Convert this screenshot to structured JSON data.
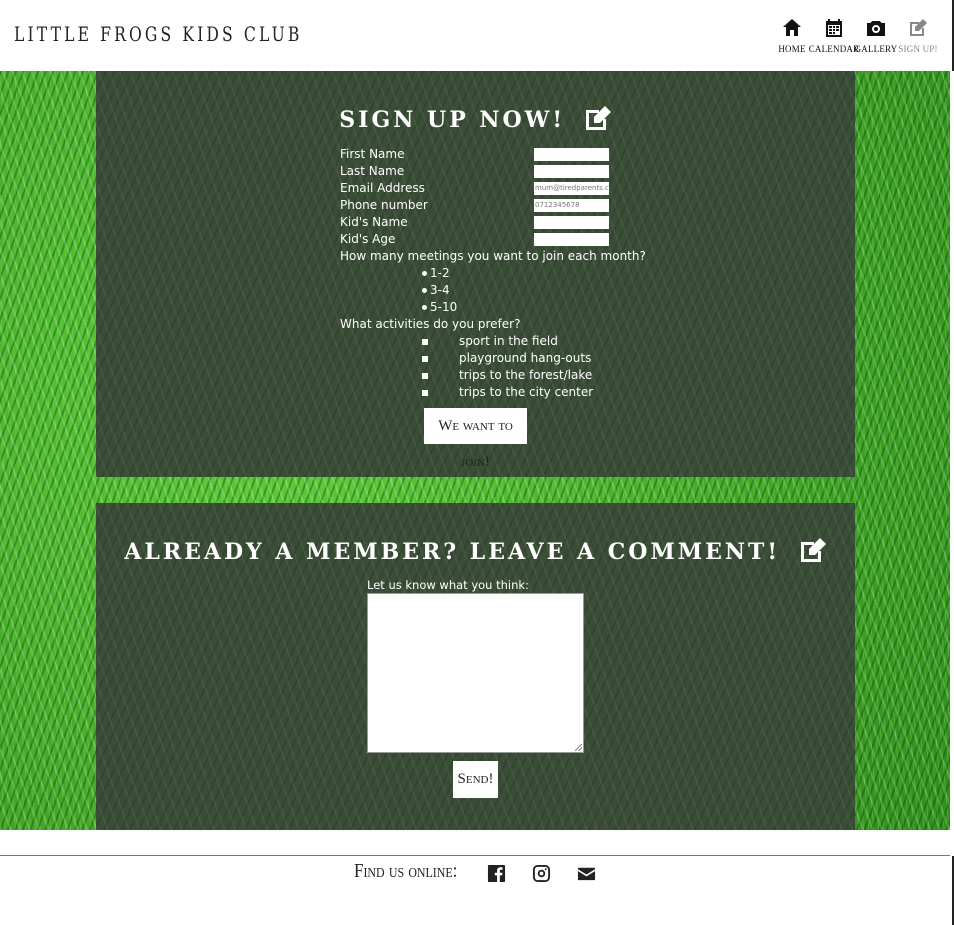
{
  "header": {
    "brand": "LITTLE FROGS KIDS CLUB",
    "nav": [
      {
        "label": "HOME",
        "icon": "home-icon"
      },
      {
        "label": "CALENDAR",
        "icon": "calendar-icon"
      },
      {
        "label": "GALLERY",
        "icon": "camera-icon"
      },
      {
        "label": "SIGN UP!",
        "icon": "edit-icon"
      }
    ]
  },
  "signup": {
    "title": "SIGN UP NOW!",
    "fields": [
      {
        "label": "First Name",
        "value": ""
      },
      {
        "label": "Last Name",
        "value": ""
      },
      {
        "label": "Email Address",
        "placeholder": "mum@tiredparents.com"
      },
      {
        "label": "Phone number",
        "placeholder": "0712345678"
      },
      {
        "label": "Kid's Name",
        "value": ""
      },
      {
        "label": "Kid's Age",
        "value": ""
      }
    ],
    "meetings_question": "How many meetings you want to join each month?",
    "meeting_options": [
      "1-2",
      "3-4",
      "5-10"
    ],
    "activities_question": "What activities do you prefer?",
    "activity_options": [
      "sport in the field",
      "playground hang-outs",
      "trips to the forest/lake",
      "trips to the city center"
    ],
    "submit_label": "We want to join!"
  },
  "comment": {
    "title": "ALREADY A MEMBER? LEAVE A COMMENT!",
    "prompt": "Let us know what you think:",
    "text": "",
    "send_label": "Send!"
  },
  "footer": {
    "label": "Find us online:",
    "icons": [
      "facebook-icon",
      "instagram-icon",
      "envelope-icon"
    ]
  },
  "colors": {
    "panel": "#3a4d36",
    "grass": "#3fae24",
    "text": "#ffffff"
  }
}
